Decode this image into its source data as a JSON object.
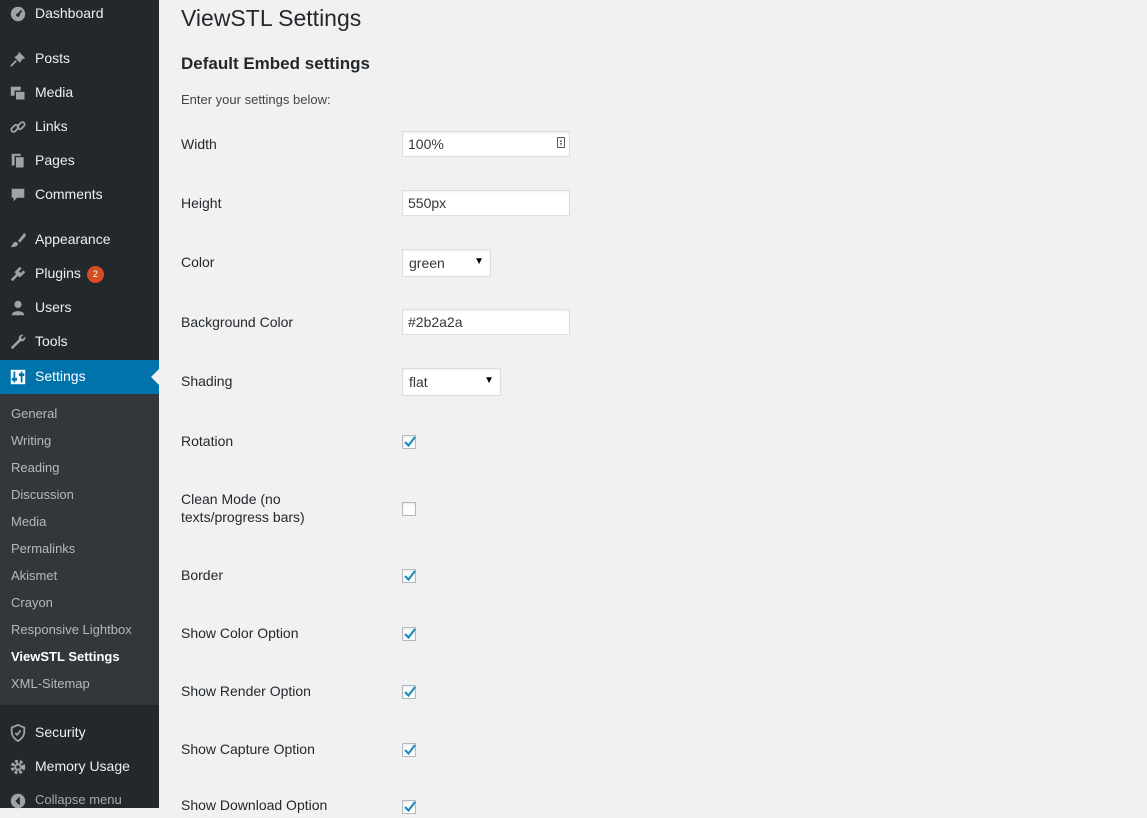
{
  "sidebar": {
    "menu": [
      {
        "label": "Dashboard",
        "icon": "dashboard-icon"
      },
      {
        "label": "Posts",
        "icon": "pin-icon"
      },
      {
        "label": "Media",
        "icon": "media-icon"
      },
      {
        "label": "Links",
        "icon": "link-icon"
      },
      {
        "label": "Pages",
        "icon": "pages-icon"
      },
      {
        "label": "Comments",
        "icon": "comment-icon"
      },
      {
        "label": "Appearance",
        "icon": "brush-icon"
      },
      {
        "label": "Plugins",
        "icon": "plugin-icon",
        "badge": "2"
      },
      {
        "label": "Users",
        "icon": "user-icon"
      },
      {
        "label": "Tools",
        "icon": "wrench-icon"
      },
      {
        "label": "Settings",
        "icon": "settings-icon",
        "active": true
      }
    ],
    "submenu": [
      "General",
      "Writing",
      "Reading",
      "Discussion",
      "Media",
      "Permalinks",
      "Akismet",
      "Crayon",
      "Responsive Lightbox",
      "ViewSTL Settings",
      "XML-Sitemap"
    ],
    "submenu_current": "ViewSTL Settings",
    "bottom_menu": [
      {
        "label": "Security",
        "icon": "shield-icon"
      },
      {
        "label": "Memory Usage",
        "icon": "gear-icon"
      }
    ],
    "collapse_label": "Collapse menu",
    "colors": {
      "bg": "#23282d",
      "submenu_bg": "#32373c",
      "active": "#0073aa",
      "badge": "#d54e21"
    }
  },
  "page": {
    "title": "ViewSTL Settings",
    "section_title": "Default Embed settings",
    "description": "Enter your settings below:",
    "fields": {
      "width": {
        "label": "Width",
        "value": "100%"
      },
      "height": {
        "label": "Height",
        "value": "550px"
      },
      "color": {
        "label": "Color",
        "value": "green"
      },
      "background_color": {
        "label": "Background Color",
        "value": "#2b2a2a"
      },
      "shading": {
        "label": "Shading",
        "value": "flat"
      },
      "rotation": {
        "label": "Rotation",
        "checked": true
      },
      "clean_mode": {
        "label_line1": "Clean Mode (no",
        "label_line2": "texts/progress bars)",
        "checked": false
      },
      "border": {
        "label": "Border",
        "checked": true
      },
      "show_color_option": {
        "label": "Show Color Option",
        "checked": true
      },
      "show_render_option": {
        "label": "Show Render Option",
        "checked": true
      },
      "show_capture_option": {
        "label": "Show Capture Option",
        "checked": true
      },
      "show_download_option": {
        "label": "Show Download Option",
        "checked": true
      }
    }
  }
}
